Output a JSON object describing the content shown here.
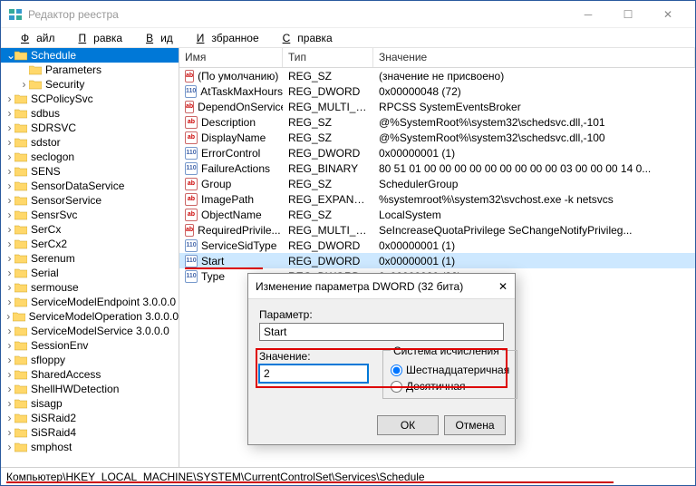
{
  "window": {
    "title": "Редактор реестра"
  },
  "menu": [
    "Файл",
    "Правка",
    "Вид",
    "Избранное",
    "Справка"
  ],
  "tree": {
    "items": [
      {
        "label": "Schedule",
        "indent": 0,
        "selected": true,
        "expand": "-"
      },
      {
        "label": "Parameters",
        "indent": 1,
        "selected": false,
        "expand": ""
      },
      {
        "label": "Security",
        "indent": 1,
        "selected": false,
        "expand": ">"
      },
      {
        "label": "SCPolicySvc",
        "indent": 0,
        "selected": false,
        "expand": ">"
      },
      {
        "label": "sdbus",
        "indent": 0,
        "selected": false,
        "expand": ">"
      },
      {
        "label": "SDRSVC",
        "indent": 0,
        "selected": false,
        "expand": ">"
      },
      {
        "label": "sdstor",
        "indent": 0,
        "selected": false,
        "expand": ">"
      },
      {
        "label": "seclogon",
        "indent": 0,
        "selected": false,
        "expand": ">"
      },
      {
        "label": "SENS",
        "indent": 0,
        "selected": false,
        "expand": ">"
      },
      {
        "label": "SensorDataService",
        "indent": 0,
        "selected": false,
        "expand": ">"
      },
      {
        "label": "SensorService",
        "indent": 0,
        "selected": false,
        "expand": ">"
      },
      {
        "label": "SensrSvc",
        "indent": 0,
        "selected": false,
        "expand": ">"
      },
      {
        "label": "SerCx",
        "indent": 0,
        "selected": false,
        "expand": ">"
      },
      {
        "label": "SerCx2",
        "indent": 0,
        "selected": false,
        "expand": ">"
      },
      {
        "label": "Serenum",
        "indent": 0,
        "selected": false,
        "expand": ">"
      },
      {
        "label": "Serial",
        "indent": 0,
        "selected": false,
        "expand": ">"
      },
      {
        "label": "sermouse",
        "indent": 0,
        "selected": false,
        "expand": ">"
      },
      {
        "label": "ServiceModelEndpoint 3.0.0.0",
        "indent": 0,
        "selected": false,
        "expand": ">"
      },
      {
        "label": "ServiceModelOperation 3.0.0.0",
        "indent": 0,
        "selected": false,
        "expand": ">"
      },
      {
        "label": "ServiceModelService 3.0.0.0",
        "indent": 0,
        "selected": false,
        "expand": ">"
      },
      {
        "label": "SessionEnv",
        "indent": 0,
        "selected": false,
        "expand": ">"
      },
      {
        "label": "sfloppy",
        "indent": 0,
        "selected": false,
        "expand": ">"
      },
      {
        "label": "SharedAccess",
        "indent": 0,
        "selected": false,
        "expand": ">"
      },
      {
        "label": "ShellHWDetection",
        "indent": 0,
        "selected": false,
        "expand": ">"
      },
      {
        "label": "sisagp",
        "indent": 0,
        "selected": false,
        "expand": ">"
      },
      {
        "label": "SiSRaid2",
        "indent": 0,
        "selected": false,
        "expand": ">"
      },
      {
        "label": "SiSRaid4",
        "indent": 0,
        "selected": false,
        "expand": ">"
      },
      {
        "label": "smphost",
        "indent": 0,
        "selected": false,
        "expand": ">"
      }
    ]
  },
  "columns": {
    "name": "Имя",
    "type": "Тип",
    "value": "Значение"
  },
  "values": [
    {
      "name": "(По умолчанию)",
      "type": "REG_SZ",
      "data": "(значение не присвоено)",
      "kind": "sz"
    },
    {
      "name": "AtTaskMaxHours",
      "type": "REG_DWORD",
      "data": "0x00000048 (72)",
      "kind": "bin"
    },
    {
      "name": "DependOnService",
      "type": "REG_MULTI_SZ",
      "data": "RPCSS SystemEventsBroker",
      "kind": "sz"
    },
    {
      "name": "Description",
      "type": "REG_SZ",
      "data": "@%SystemRoot%\\system32\\schedsvc.dll,-101",
      "kind": "sz"
    },
    {
      "name": "DisplayName",
      "type": "REG_SZ",
      "data": "@%SystemRoot%\\system32\\schedsvc.dll,-100",
      "kind": "sz"
    },
    {
      "name": "ErrorControl",
      "type": "REG_DWORD",
      "data": "0x00000001 (1)",
      "kind": "bin"
    },
    {
      "name": "FailureActions",
      "type": "REG_BINARY",
      "data": "80 51 01 00 00 00 00 00 00 00 00 00 03 00 00 00 14 0...",
      "kind": "bin"
    },
    {
      "name": "Group",
      "type": "REG_SZ",
      "data": "SchedulerGroup",
      "kind": "sz"
    },
    {
      "name": "ImagePath",
      "type": "REG_EXPAND_SZ",
      "data": "%systemroot%\\system32\\svchost.exe -k netsvcs",
      "kind": "sz"
    },
    {
      "name": "ObjectName",
      "type": "REG_SZ",
      "data": "LocalSystem",
      "kind": "sz"
    },
    {
      "name": "RequiredPrivile...",
      "type": "REG_MULTI_SZ",
      "data": "SeIncreaseQuotaPrivilege SeChangeNotifyPrivileg...",
      "kind": "sz"
    },
    {
      "name": "ServiceSidType",
      "type": "REG_DWORD",
      "data": "0x00000001 (1)",
      "kind": "bin"
    },
    {
      "name": "Start",
      "type": "REG_DWORD",
      "data": "0x00000001 (1)",
      "kind": "bin",
      "selected": true
    },
    {
      "name": "Type",
      "type": "REG_DWORD",
      "data": "0x00000020 (32)",
      "kind": "bin"
    }
  ],
  "dialog": {
    "title": "Изменение параметра DWORD (32 бита)",
    "param_label": "Параметр:",
    "param_value": "Start",
    "value_label": "Значение:",
    "value_value": "2",
    "base_label": "Система исчисления",
    "radio_hex": "Шестнадцатеричная",
    "radio_dec": "Десятичная",
    "ok": "ОК",
    "cancel": "Отмена"
  },
  "statusbar": "Компьютер\\HKEY_LOCAL_MACHINE\\SYSTEM\\CurrentControlSet\\Services\\Schedule"
}
